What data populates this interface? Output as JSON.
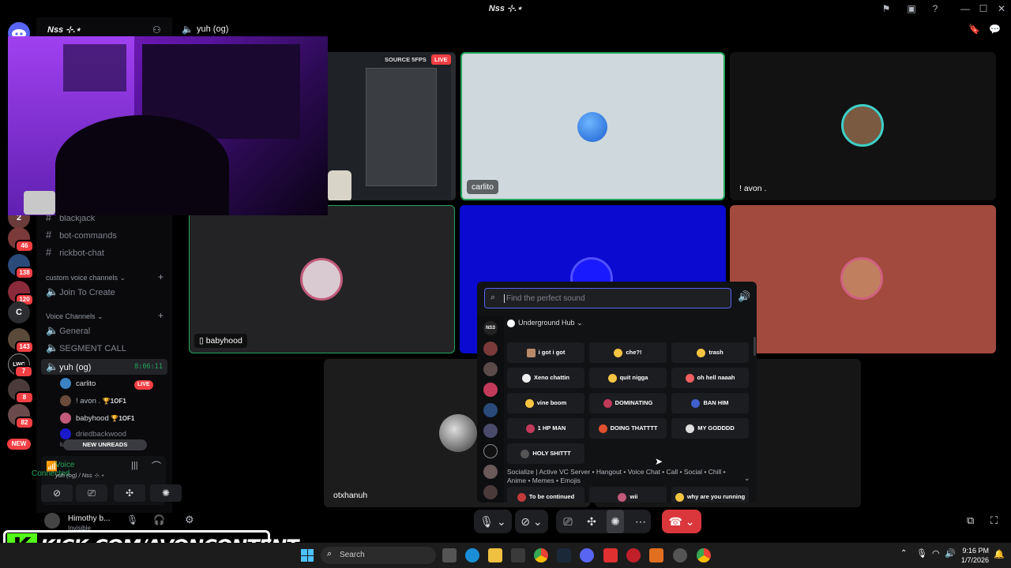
{
  "window": {
    "title": "Nss ⊹.⋆",
    "controls": [
      "—",
      "☐",
      "✕"
    ]
  },
  "server": {
    "name": "Nss ⊹.⋆"
  },
  "rail": [
    {
      "label": "2",
      "badge": ""
    },
    {
      "label": "",
      "badge": "46"
    },
    {
      "label": "",
      "badge": "138"
    },
    {
      "label": "",
      "badge": "120"
    },
    {
      "label": "C",
      "badge": ""
    },
    {
      "label": "",
      "badge": "143"
    },
    {
      "label": "LWC",
      "badge": "7"
    },
    {
      "label": "",
      "badge": "8"
    },
    {
      "label": "",
      "badge": "82"
    }
  ],
  "rail_new": "NEW",
  "channels": {
    "text": [
      {
        "name": "blackjack"
      },
      {
        "name": "bot-commands"
      },
      {
        "name": "rickbot-chat"
      }
    ],
    "cat_custom": "custom voice channels",
    "custom": [
      {
        "name": "Join To Create"
      }
    ],
    "cat_voice": "Voice Channels",
    "voice": [
      {
        "name": "General"
      },
      {
        "name": "SEGMENT CALL"
      },
      {
        "name": "yuh (og)",
        "timer": "8:06:11"
      }
    ],
    "members": [
      {
        "name": "carlito",
        "tag": "LIVE"
      },
      {
        "name": "! avon .",
        "tag": "1OF1"
      },
      {
        "name": "babyhood",
        "tag": "1OF1"
      },
      {
        "name": "driedbackwood",
        "tag": ""
      },
      {
        "name": "luu",
        "tag": ""
      }
    ],
    "new_unreads": "NEW UNREADS"
  },
  "voice_panel": {
    "status": "Voice Connected",
    "channel": "yuh (og) / Nss ⊹.⋆"
  },
  "user_panel": {
    "name": "Himothy b...",
    "status": "Invisible"
  },
  "header": {
    "channel": "yuh (og)"
  },
  "tiles": {
    "stream_badge": "SOURCE 5FPS",
    "live": "LIVE",
    "carlito": "carlito",
    "avon": "! avon .",
    "babyhood": "babyhood",
    "otxhanuh": "otxhanuh"
  },
  "soundboard": {
    "search_placeholder": "Find the perfect sound",
    "section": "Underground Hub",
    "sounds": [
      [
        "i got i got",
        "che?!",
        "trash"
      ],
      [
        "Xeno chattin",
        "quit nigga",
        "oh hell naaah"
      ],
      [
        "vine boom",
        "DOMINATING",
        "BAN HIM"
      ],
      [
        "1 HP MAN",
        "DOING THATTTT",
        "MY GODDDD"
      ],
      [
        "HOLY SHITTT"
      ]
    ],
    "section2": "Socialize | Active VC Server • Hangout • Voice Chat • Call • Social • Chill • Anime • Memes • Emojis",
    "sounds2": [
      "To be continued",
      "wii",
      "why are you running"
    ]
  },
  "overlay": {
    "text": "KICK.COM/AVONCONTENT",
    "logo": "K"
  },
  "taskbar": {
    "search": "Search",
    "time": "9:16 PM",
    "date": "1/7/2026"
  },
  "colors": {
    "accent": "#5865f2",
    "live": "#f23f43",
    "green": "#23a55a",
    "hangup": "#da373c",
    "kick": "#53fc18"
  }
}
